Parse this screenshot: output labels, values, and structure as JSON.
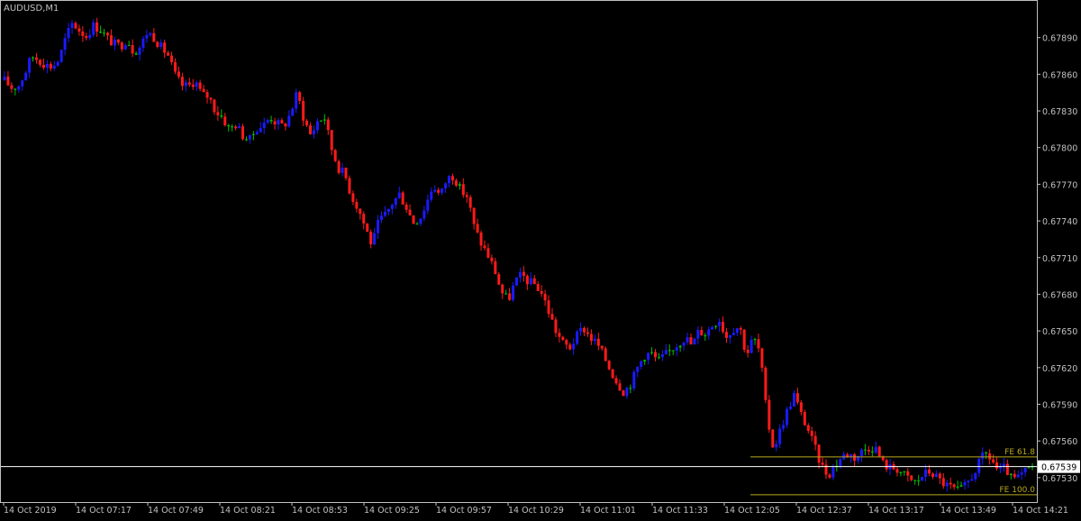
{
  "window": {
    "symbol_label": "AUDUSD,M1"
  },
  "colors": {
    "background": "#000000",
    "frame": "#c0c0c0",
    "text": "#c0c0c0",
    "bull": "#1a1aff",
    "bear": "#ff1a1a",
    "doji": "#00c000",
    "fibo": "#b8a81e",
    "price_line": "#ffffff"
  },
  "chart_data": {
    "type": "candlestick",
    "symbol": "AUDUSD",
    "timeframe": "M1",
    "ylim": [
      0.6751,
      0.6792
    ],
    "y_ticks": [
      "0.67890",
      "0.67860",
      "0.67830",
      "0.67800",
      "0.67770",
      "0.67740",
      "0.67710",
      "0.67680",
      "0.67650",
      "0.67620",
      "0.67590",
      "0.67560",
      "0.67530"
    ],
    "x_ticks": [
      "14 Oct 2019",
      "14 Oct 07:17",
      "14 Oct 07:49",
      "14 Oct 08:21",
      "14 Oct 08:53",
      "14 Oct 09:25",
      "14 Oct 09:57",
      "14 Oct 10:29",
      "14 Oct 11:01",
      "14 Oct 11:33",
      "14 Oct 12:05",
      "14 Oct 12:37",
      "14 Oct 13:17",
      "14 Oct 13:49",
      "14 Oct 14:21"
    ],
    "current_price": "0.67539",
    "close_path": [
      0.67855,
      0.67849,
      0.6785,
      0.67861,
      0.67875,
      0.67872,
      0.67868,
      0.67866,
      0.67872,
      0.6789,
      0.67902,
      0.67896,
      0.67891,
      0.679,
      0.67897,
      0.6789,
      0.67885,
      0.67883,
      0.67889,
      0.67878,
      0.67883,
      0.67895,
      0.6789,
      0.67882,
      0.67876,
      0.6786,
      0.67851,
      0.6785,
      0.67855,
      0.67843,
      0.67842,
      0.6783,
      0.67825,
      0.67815,
      0.67819,
      0.6781,
      0.67806,
      0.67816,
      0.67818,
      0.67825,
      0.6782,
      0.67817,
      0.67828,
      0.67845,
      0.67823,
      0.6781,
      0.67822,
      0.67825,
      0.678,
      0.67784,
      0.67778,
      0.6776,
      0.6775,
      0.67735,
      0.6772,
      0.6774,
      0.67745,
      0.67755,
      0.67762,
      0.67752,
      0.67739,
      0.67742,
      0.67755,
      0.6777,
      0.6776,
      0.67775,
      0.67777,
      0.67765,
      0.6776,
      0.67735,
      0.67722,
      0.67712,
      0.677,
      0.67682,
      0.67675,
      0.6769,
      0.67696,
      0.6769,
      0.67688,
      0.6768,
      0.67665,
      0.6765,
      0.6764,
      0.67636,
      0.67645,
      0.67653,
      0.67645,
      0.6764,
      0.6763,
      0.67618,
      0.67608,
      0.676,
      0.67607,
      0.6762,
      0.6763,
      0.67632,
      0.67625,
      0.6763,
      0.67635,
      0.6764,
      0.67645,
      0.67638,
      0.6765,
      0.67648,
      0.67655,
      0.6766,
      0.67645,
      0.67652,
      0.67654,
      0.6763,
      0.67645,
      0.67632,
      0.6758,
      0.67553,
      0.6757,
      0.67585,
      0.67598,
      0.67582,
      0.6757,
      0.67555,
      0.6754,
      0.67532,
      0.6754,
      0.67547,
      0.6755,
      0.67546,
      0.67552,
      0.67555,
      0.67554,
      0.67542,
      0.67538,
      0.67538,
      0.67533,
      0.67528,
      0.67526,
      0.67533,
      0.67535,
      0.6753,
      0.67525,
      0.67522,
      0.67519,
      0.67522,
      0.6753,
      0.6754,
      0.6755,
      0.67545,
      0.67535,
      0.67538,
      0.67528,
      0.6753,
      0.67535,
      0.67539
    ],
    "fibo_levels": [
      {
        "label": "FE 61.8",
        "price": 0.67547
      },
      {
        "label": "FE 100.0",
        "price": 0.67516
      }
    ],
    "grid": false,
    "legend": "none"
  }
}
